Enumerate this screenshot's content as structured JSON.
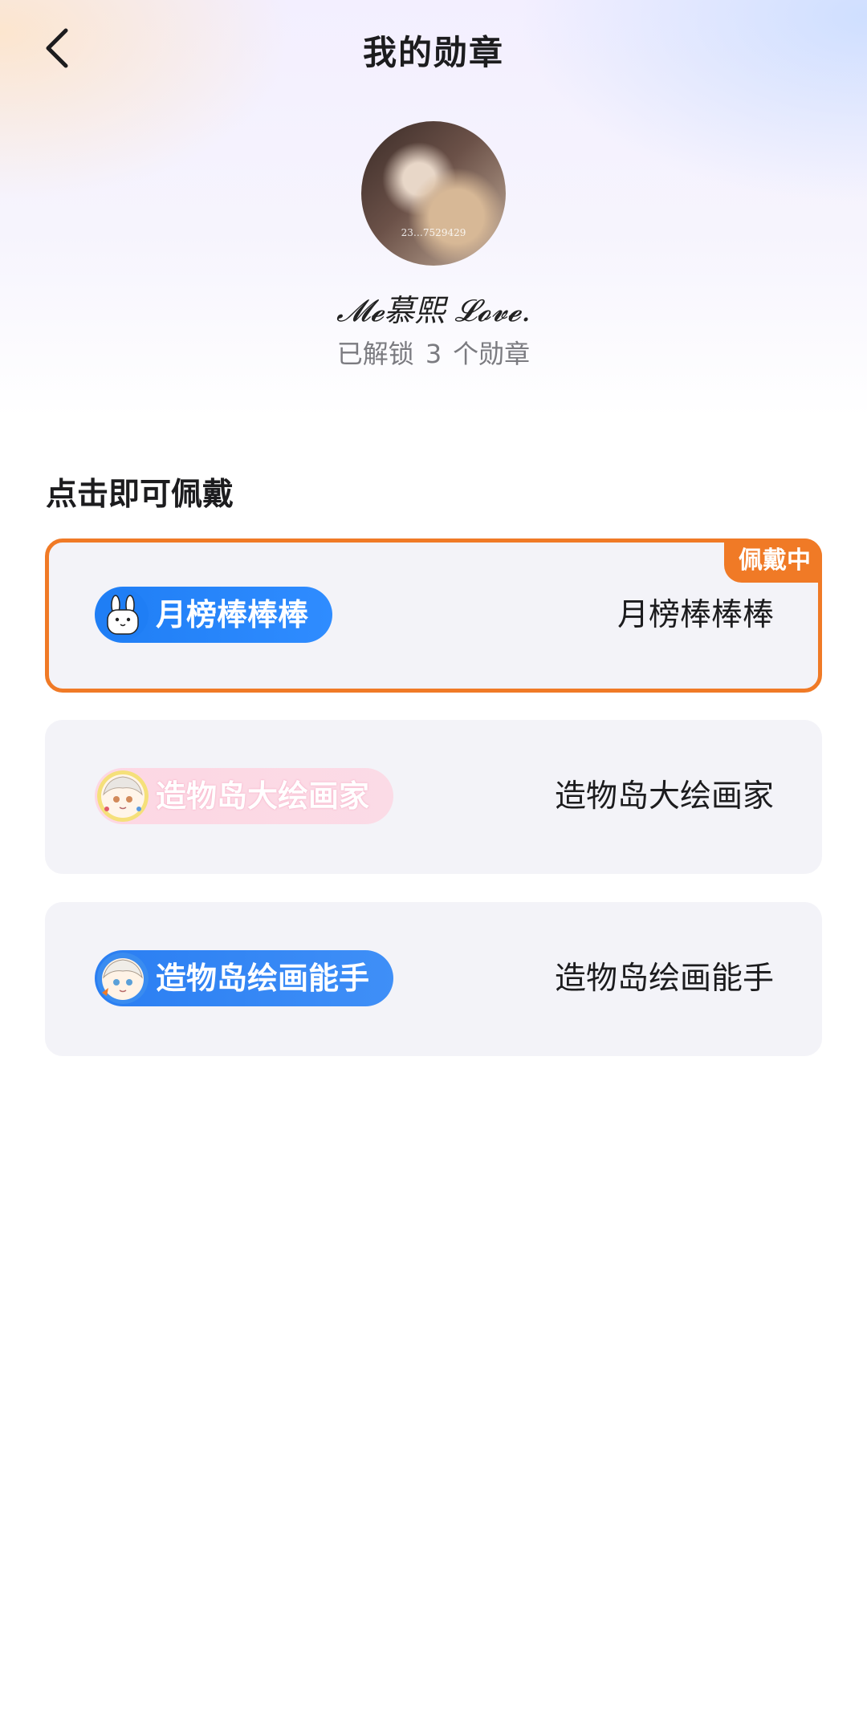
{
  "header": {
    "title": "我的勋章",
    "back_icon": "chevron-left-icon"
  },
  "profile": {
    "avatar_caption": "23…7529429",
    "nickname": "𝓜𝓮慕熙 𝓛𝓸𝓿𝓮.",
    "unlocked_prefix": "已解锁",
    "unlocked_count": "3",
    "unlocked_suffix": "个勋章"
  },
  "section_title": "点击即可佩戴",
  "badges": [
    {
      "badge_text": "月榜棒棒棒",
      "name": "月榜棒棒棒",
      "worn": true,
      "worn_label": "佩戴中",
      "icon": "rabbit-icon",
      "color": "#1f7ef5"
    },
    {
      "badge_text": "造物岛大绘画家",
      "name": "造物岛大绘画家",
      "worn": false,
      "icon": "anime-girl-icon",
      "color": "#fdd7e3"
    },
    {
      "badge_text": "造物岛绘画能手",
      "name": "造物岛绘画能手",
      "worn": false,
      "icon": "anime-girl-icon",
      "color": "#2a7ef2"
    }
  ],
  "colors": {
    "accent": "#f07a26",
    "card_bg": "#f3f3f8"
  }
}
